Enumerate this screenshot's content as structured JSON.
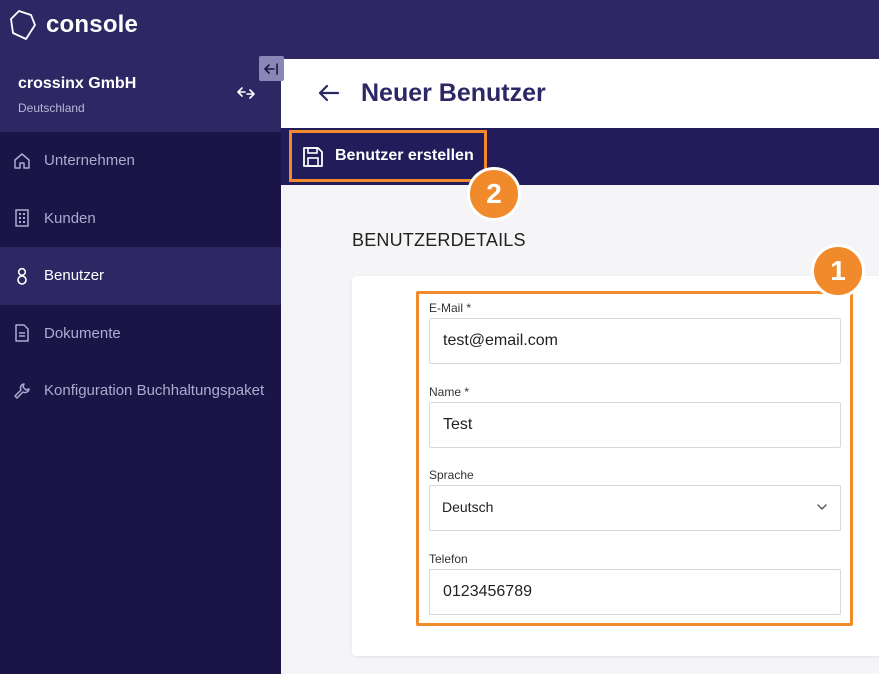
{
  "app": {
    "title": "console"
  },
  "sidebar": {
    "company_name": "crossinx GmbH",
    "company_country": "Deutschland",
    "items": [
      {
        "label": "Unternehmen",
        "icon": "home-icon",
        "active": false
      },
      {
        "label": "Kunden",
        "icon": "building-icon",
        "active": false
      },
      {
        "label": "Benutzer",
        "icon": "user-icon",
        "active": true
      },
      {
        "label": "Dokumente",
        "icon": "document-icon",
        "active": false
      },
      {
        "label": "Konfiguration Buchhaltungspaket",
        "icon": "wrench-icon",
        "active": false
      }
    ]
  },
  "header": {
    "title": "Neuer Benutzer"
  },
  "toolbar": {
    "save_label": "Benutzer erstellen"
  },
  "section": {
    "title": "BENUTZERDETAILS"
  },
  "form": {
    "email": {
      "label": "E-Mail *",
      "value": "test@email.com"
    },
    "name": {
      "label": "Name *",
      "value": "Test"
    },
    "language": {
      "label": "Sprache",
      "value": "Deutsch"
    },
    "phone": {
      "label": "Telefon",
      "value": "0123456789"
    }
  },
  "annotations": {
    "step1": "1",
    "step2": "2"
  },
  "colors": {
    "brand": "#2d2864",
    "sidebar": "#1a1447",
    "accent": "#f08a2a"
  }
}
